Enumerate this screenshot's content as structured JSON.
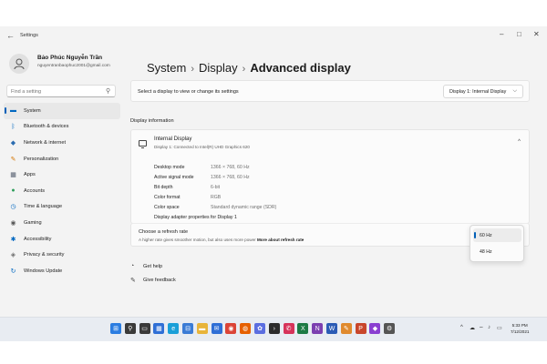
{
  "window": {
    "title": "Settings",
    "back_glyph": "←",
    "minimize_glyph": "–",
    "maximize_glyph": "□",
    "close_glyph": "✕"
  },
  "user": {
    "name": "Bảo Phúc Nguyễn Trần",
    "email": "nguyentranbaophuc2001@gmail.com"
  },
  "search": {
    "placeholder": "Find a setting",
    "icon": "search-icon"
  },
  "nav": [
    {
      "label": "System",
      "icon": "monitor-icon",
      "color": "#0067c0",
      "active": true
    },
    {
      "label": "Bluetooth & devices",
      "icon": "bluetooth-icon",
      "color": "#0067c0"
    },
    {
      "label": "Network & internet",
      "icon": "wifi-icon",
      "color": "#2b6cb0"
    },
    {
      "label": "Personalization",
      "icon": "brush-icon",
      "color": "#d47500"
    },
    {
      "label": "Apps",
      "icon": "apps-icon",
      "color": "#505a6b"
    },
    {
      "label": "Accounts",
      "icon": "person-icon",
      "color": "#2e9e5b"
    },
    {
      "label": "Time & language",
      "icon": "globe-clock-icon",
      "color": "#0067c0"
    },
    {
      "label": "Gaming",
      "icon": "gamepad-icon",
      "color": "#5a5a5a"
    },
    {
      "label": "Accessibility",
      "icon": "accessibility-icon",
      "color": "#0067c0"
    },
    {
      "label": "Privacy & security",
      "icon": "shield-icon",
      "color": "#6b6b6b"
    },
    {
      "label": "Windows Update",
      "icon": "update-icon",
      "color": "#0067c0"
    }
  ],
  "breadcrumb": {
    "items": [
      "System",
      "Display"
    ],
    "separator": "›",
    "current": "Advanced display"
  },
  "selector": {
    "text": "Select a display to view or change its settings",
    "value": "Display 1: Internal Display",
    "chevron": "⌵"
  },
  "display_info": {
    "heading": "Display information",
    "name": "Internal Display",
    "subtitle": "Display 1: Connected to Intel(R) UHD Graphics 620",
    "collapse_glyph": "^",
    "properties": [
      {
        "key": "Desktop mode",
        "value": "1366 × 768, 60 Hz"
      },
      {
        "key": "Active signal mode",
        "value": "1366 × 768, 60 Hz"
      },
      {
        "key": "Bit depth",
        "value": "6-bit"
      },
      {
        "key": "Color format",
        "value": "RGB"
      },
      {
        "key": "Color space",
        "value": "Standard dynamic range (SDR)"
      }
    ],
    "adapter_link": "Display adapter properties for Display 1"
  },
  "refresh": {
    "title": "Choose a refresh rate",
    "subtitle": "A higher rate gives smoother motion, but also uses more power",
    "more_link": "More about refresh rate",
    "options": [
      "60 Hz",
      "48 Hz"
    ],
    "selected": "60 Hz"
  },
  "help": {
    "get_help": "Get help",
    "give_feedback": "Give feedback"
  },
  "taskbar": {
    "apps": [
      {
        "icon": "windows-start-icon",
        "color": "#2b7de1",
        "glyph": "⊞"
      },
      {
        "icon": "search-icon",
        "color": "#3a3a3a",
        "glyph": "⚲"
      },
      {
        "icon": "task-view-icon",
        "color": "#3a3a3a",
        "glyph": "▭"
      },
      {
        "icon": "widgets-icon",
        "color": "#2f6fd6",
        "glyph": "▦"
      },
      {
        "icon": "edge-icon",
        "color": "#1a9fd8",
        "glyph": "e"
      },
      {
        "icon": "store-icon",
        "color": "#3a7bd5",
        "glyph": "⊟"
      },
      {
        "icon": "file-explorer-icon",
        "color": "#e8b43a",
        "glyph": "▬"
      },
      {
        "icon": "mail-icon",
        "color": "#2f6fd6",
        "glyph": "✉"
      },
      {
        "icon": "chrome-icon",
        "color": "#db4437",
        "glyph": "◉"
      },
      {
        "icon": "firefox-icon",
        "color": "#e66000",
        "glyph": "◍"
      },
      {
        "icon": "photos-icon",
        "color": "#5b6ee0",
        "glyph": "✿"
      },
      {
        "icon": "terminal-icon",
        "color": "#2c2c2c",
        "glyph": "›"
      },
      {
        "icon": "messenger-icon",
        "color": "#d6335a",
        "glyph": "✆"
      },
      {
        "icon": "excel-icon",
        "color": "#1d7a45",
        "glyph": "X"
      },
      {
        "icon": "onenote-icon",
        "color": "#7b3fb0",
        "glyph": "N"
      },
      {
        "icon": "word-icon",
        "color": "#2b5bb5",
        "glyph": "W"
      },
      {
        "icon": "paint-icon",
        "color": "#e08a2e",
        "glyph": "✎"
      },
      {
        "icon": "powerpoint-icon",
        "color": "#c8462b",
        "glyph": "P"
      },
      {
        "icon": "app-badge-icon",
        "color": "#8a3fd1",
        "glyph": "◆"
      },
      {
        "icon": "settings-gear-icon",
        "color": "#555555",
        "glyph": "⚙"
      }
    ],
    "tray": [
      "^",
      "☁",
      "⌔",
      "♪",
      "▭"
    ],
    "time": "5:33 PM",
    "date": "7/12/2021"
  }
}
